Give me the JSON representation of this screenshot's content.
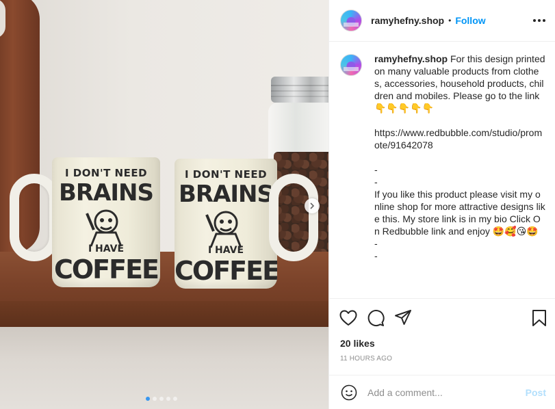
{
  "post": {
    "username": "ramyhefny.shop",
    "separator": "•",
    "follow_label": "Follow",
    "more_icon": "more-horizontal-icon"
  },
  "media": {
    "mug_text_top": "I DON'T NEED",
    "mug_text_brains": "BRAINS",
    "mug_text_have": "I HAVE",
    "mug_text_coffee": "COFFEE",
    "carousel_count": 5,
    "carousel_active": 1
  },
  "caption": {
    "username": "ramyhefny.shop",
    "body": " For this design printed on many valuable products from clothes, accessories, household products, children and mobiles. Please go to the link 👇👇👇👇👇\n\nhttps://www.redbubble.com/studio/promote/91642078\n\n-\n-\nIf you like this product please visit my online shop for more attractive designs like this. My store link is in my bio Click On Redbubble link and enjoy 🤩🥰😘🤩\n-\n-"
  },
  "stats": {
    "likes": "20 likes",
    "time_ago": "11 HOURS AGO"
  },
  "comment": {
    "placeholder": "Add a comment...",
    "post_label": "Post"
  },
  "colors": {
    "accent": "#0095f6",
    "post_disabled": "#b2dffc",
    "carousel_active": "#3897f0"
  }
}
